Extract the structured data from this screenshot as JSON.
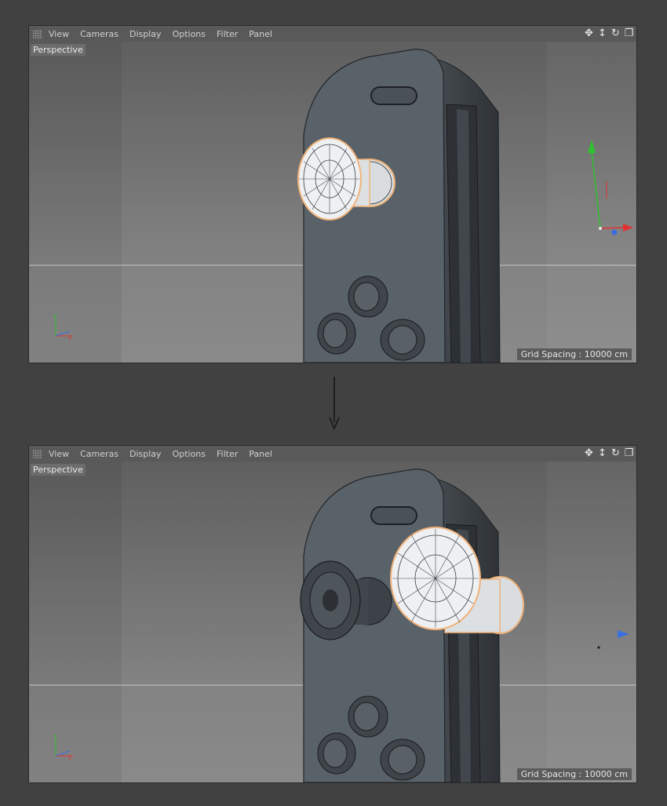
{
  "viewports": [
    {
      "menu": [
        "View",
        "Cameras",
        "Display",
        "Options",
        "Filter",
        "Panel"
      ],
      "label": "Perspective",
      "grid_spacing": "Grid Spacing : 10000 cm"
    },
    {
      "menu": [
        "View",
        "Cameras",
        "Display",
        "Options",
        "Filter",
        "Panel"
      ],
      "label": "Perspective",
      "grid_spacing": "Grid Spacing : 10000 cm"
    }
  ],
  "icons": {
    "nav": [
      "move-icon",
      "zoom-icon",
      "rotate-icon",
      "maximize-icon"
    ]
  },
  "colors": {
    "background": "#414141",
    "viewport_bg_top": "#5f5f5f",
    "viewport_bg_bottom": "#8a8a8a",
    "selection": "#f0b27a",
    "axis_x": "#e23232",
    "axis_y": "#2fc22f",
    "axis_z": "#3a6fe0"
  }
}
